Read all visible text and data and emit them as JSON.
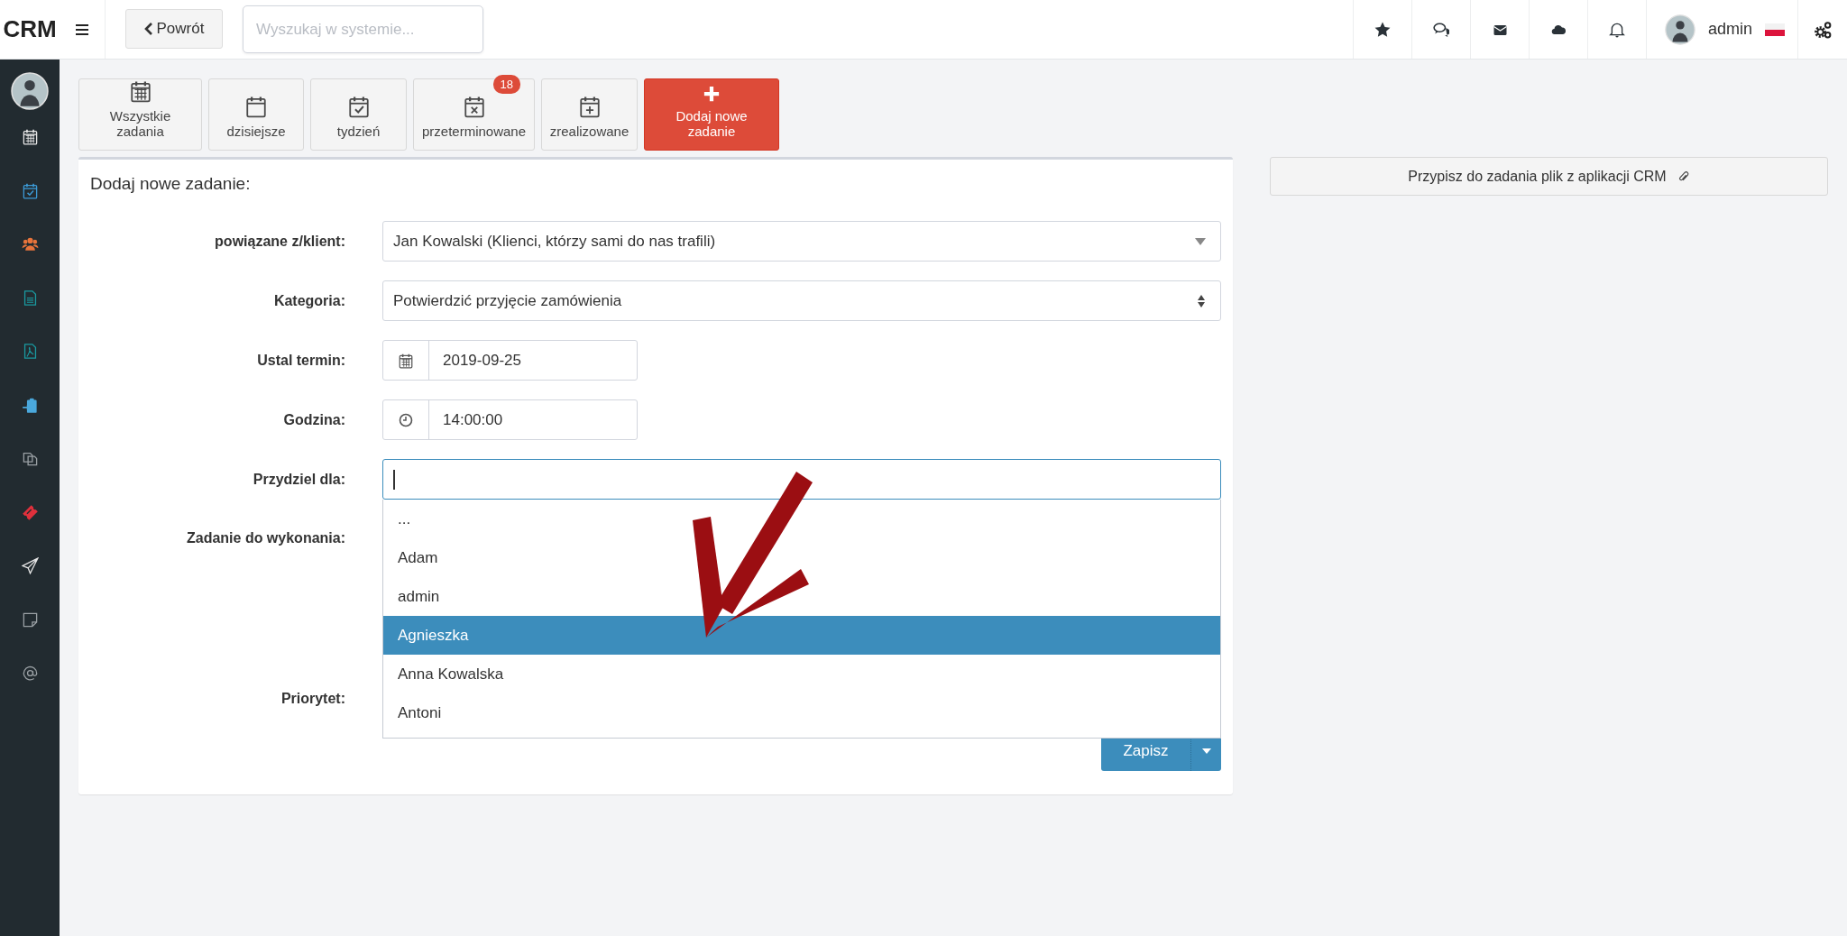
{
  "topbar": {
    "logo": "CRM",
    "back_button": "Powrót",
    "search": {
      "placeholder": "Wyszukaj w systemie..."
    },
    "user": "admin"
  },
  "tabs": [
    {
      "kind": "filter",
      "label": "Wszystkie zadania"
    },
    {
      "kind": "filter",
      "label": "dzisiejsze"
    },
    {
      "kind": "filter",
      "label": "tydzień"
    },
    {
      "kind": "filter",
      "label": "przeterminowane",
      "badge": "18"
    },
    {
      "kind": "filter",
      "label": "zrealizowane"
    },
    {
      "kind": "add",
      "label": "Dodaj nowe zadanie"
    }
  ],
  "form": {
    "title": "Dodaj nowe zadanie:",
    "fields": [
      {
        "kind": "select",
        "label": "powiązane z/klient:",
        "value": "Jan Kowalski (Klienci, którzy sami do nas trafili)"
      },
      {
        "kind": "spinner",
        "label": "Kategoria:",
        "value": "Potwierdzić przyjęcie zamówienia"
      },
      {
        "kind": "date",
        "label": "Ustal termin:",
        "value": "2019-09-25"
      },
      {
        "kind": "time",
        "label": "Godzina:",
        "value": "14:00:00"
      },
      {
        "kind": "combo",
        "label": "Przydziel dla:",
        "options": [
          {
            "label": "...",
            "selected": false
          },
          {
            "label": "Adam",
            "selected": false
          },
          {
            "label": "admin",
            "selected": false
          },
          {
            "label": "Agnieszka",
            "selected": true
          },
          {
            "label": "Anna Kowalska",
            "selected": false
          },
          {
            "label": "Antoni",
            "selected": false
          }
        ]
      },
      {
        "kind": "covered-tall",
        "label": "Zadanie do wykonania:"
      },
      {
        "kind": "covered",
        "label": "Priorytet:"
      }
    ],
    "save_button": "Zapisz"
  },
  "attach_button": "Przypisz do zadania plik z aplikacji CRM"
}
